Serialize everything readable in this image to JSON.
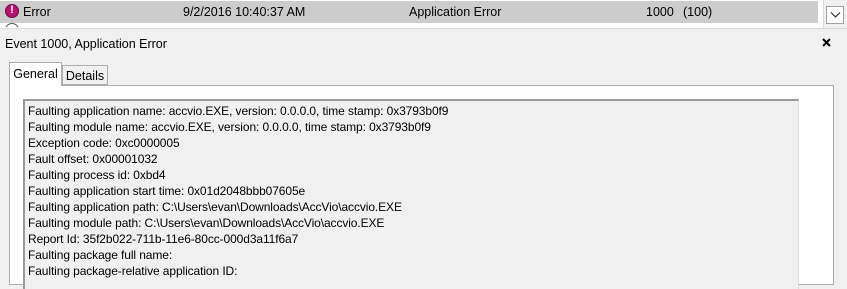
{
  "event_list": {
    "row": {
      "level": "Error",
      "date_time": "9/2/2016 10:40:37 AM",
      "source": "Application Error",
      "event_id": "1000",
      "task_category": "(100)"
    }
  },
  "detail": {
    "title": "Event 1000, Application Error",
    "tabs": [
      "General",
      "Details"
    ],
    "selected_tab": "General",
    "description_lines": [
      "Faulting application name: accvio.EXE, version: 0.0.0.0, time stamp: 0x3793b0f9",
      "Faulting module name: accvio.EXE, version: 0.0.0.0, time stamp: 0x3793b0f9",
      "Exception code: 0xc0000005",
      "Fault offset: 0x00001032",
      "Faulting process id: 0xbd4",
      "Faulting application start time: 0x01d2048bbb07605e",
      "Faulting application path: C:\\Users\\evan\\Downloads\\AccVio\\accvio.EXE",
      "Faulting module path: C:\\Users\\evan\\Downloads\\AccVio\\accvio.EXE",
      "Report Id: 35f2b022-711b-11e6-80cc-000d3a11f6a7",
      "Faulting package full name:",
      "Faulting package-relative application ID:"
    ]
  },
  "icons": {
    "error": "error-icon",
    "close": "close-icon",
    "scroll_down": "chevron-down-icon"
  },
  "colors": {
    "selected_row": "#cccccc",
    "error_icon": "#b3126f",
    "background": "#f0f0f0"
  }
}
